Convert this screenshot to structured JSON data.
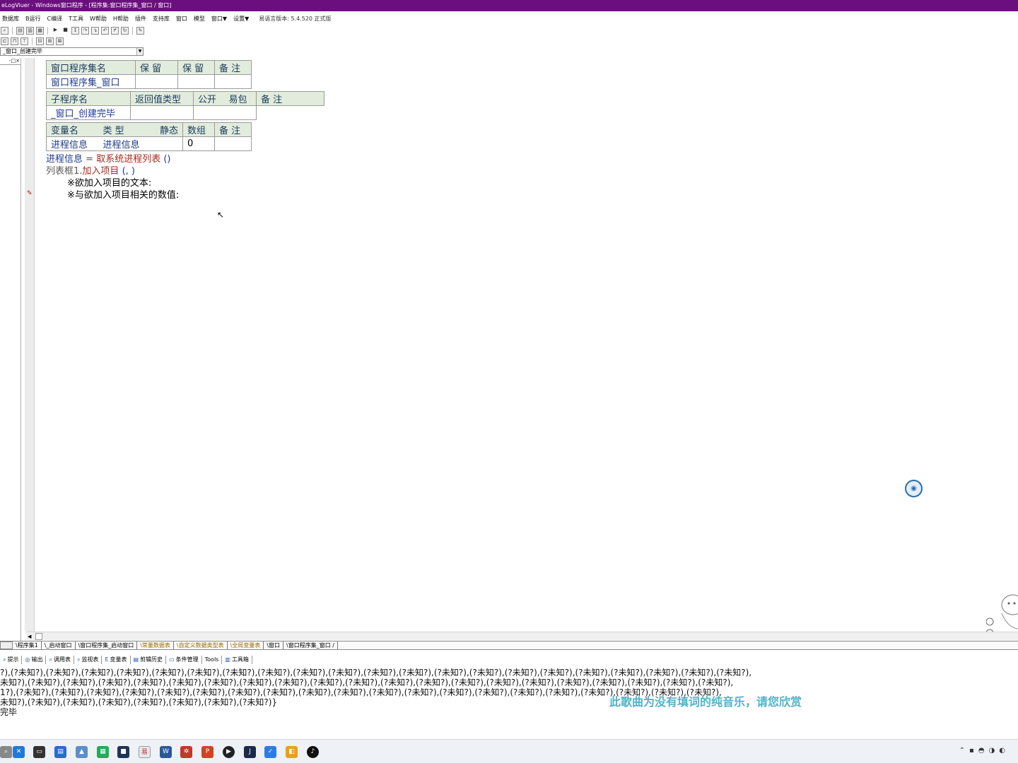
{
  "window": {
    "title": "eLogViuer - Windows窗口程序 - [程序集:窗口程序集_窗口 / 窗口]"
  },
  "menu": {
    "items": [
      "数据库",
      "B运行",
      "C编译",
      "T工具",
      "W帮助",
      "H帮助",
      "插件",
      "支持库",
      "窗口",
      "模型",
      "窗口▼",
      "设置▼"
    ],
    "version_label": "易语言版本: 5.4.520 正式版"
  },
  "combo": {
    "value": "_窗口_创建完毕"
  },
  "code": {
    "assembly_table": {
      "headers": [
        "窗口程序集名",
        "保 留",
        "保 留",
        "备 注"
      ],
      "row": [
        "窗口程序集_窗口",
        "",
        "",
        ""
      ]
    },
    "sub_table": {
      "headers": [
        "子程序名",
        "返回值类型",
        "公开",
        "易包",
        "备 注"
      ],
      "row": [
        "_窗口_创建完毕",
        "",
        "",
        "",
        ""
      ]
    },
    "var_table": {
      "headers": [
        "变量名",
        "类 型",
        "静态",
        "数组",
        "备 注"
      ],
      "row": [
        "进程信息",
        "进程信息",
        "",
        "0",
        ""
      ]
    },
    "lines": {
      "l1_var": "进程信息",
      "l1_eq": "=",
      "l1_func": "取系统进程列表",
      "l1_args": "()",
      "l2_obj": "列表框1.",
      "l2_method": "加入项目",
      "l2_args": "(, )",
      "l3": "※欲加入项目的文本:",
      "l4": "※与欲加入项目相关的数值:"
    }
  },
  "bottom_tabs": [
    "\\程序集1",
    "\\_启动窗口",
    "\\窗口程序集_启动窗口",
    "\\常量数据表",
    "\\自定义数据类型表",
    "\\全局变量表",
    "\\窗口",
    "\\窗口程序集_窗口 /"
  ],
  "output_tabs": [
    "提示",
    "输出",
    "调用表",
    "监视表",
    "变量表",
    "剪辑历史",
    "条件管理",
    "Tools",
    "工具箱"
  ],
  "output": {
    "lines": [
      "?),(?未知?),(?未知?),(?未知?),(?未知?),(?未知?),(?未知?),(?未知?),(?未知?),(?未知?),(?未知?),(?未知?),(?未知?),(?未知?),(?未知?),(?未知?),(?未知?),(?未知?),(?未知?),(?未知?),(?未知?),(?未知?),",
      "未知?),(?未知?),(?未知?),(?未知?),(?未知?),(?未知?),(?未知?),(?未知?),(?未知?),(?未知?),(?未知?),(?未知?),(?未知?),(?未知?),(?未知?),(?未知?),(?未知?),(?未知?),(?未知?),(?未知?),(?未知?),",
      "1?),(?未知?),(?未知?),(?未知?),(?未知?),(?未知?),(?未知?),(?未知?),(?未知?),(?未知?),(?未知?),(?未知?),(?未知?),(?未知?),(?未知?),(?未知?),(?未知?),(?未知?),(?未知?),(?未知?),(?未知?),",
      "未知?),(?未知?),(?未知?),(?未知?),(?未知?),(?未知?),(?未知?),(?未知?)}",
      "完毕"
    ],
    "subtitle": "此歌曲为没有填词的纯音乐，请您欣赏"
  },
  "colors": {
    "titlebar": "#6b0f7e",
    "table_header": "#e2ecdc",
    "code_blue": "#1f3b8c",
    "code_red": "#a62b1f",
    "subtitle": "#4fb3c8"
  }
}
